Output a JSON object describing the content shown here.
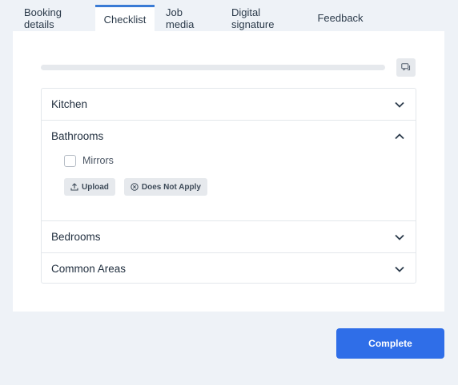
{
  "tabs": [
    {
      "label": "Booking details"
    },
    {
      "label": "Checklist"
    },
    {
      "label": "Job media"
    },
    {
      "label": "Digital signature"
    },
    {
      "label": "Feedback"
    }
  ],
  "active_tab": "Checklist",
  "progress": {
    "fraction": 0.0
  },
  "comment_icon": "comment-icon",
  "sections": [
    {
      "title": "Kitchen",
      "expanded": false
    },
    {
      "title": "Bathrooms",
      "expanded": true,
      "items": [
        {
          "label": "Mirrors",
          "checked": false
        }
      ],
      "actions": [
        {
          "label": "Upload",
          "icon": "upload-icon"
        },
        {
          "label": "Does Not Apply",
          "icon": "circle-x-icon"
        }
      ]
    },
    {
      "title": "Bedrooms",
      "expanded": false
    },
    {
      "title": "Common Areas",
      "expanded": false
    }
  ],
  "complete_label": "Complete",
  "colors": {
    "accent": "#3a7bd5",
    "primary_button": "#2f6ee8",
    "background": "#eef2f7"
  }
}
